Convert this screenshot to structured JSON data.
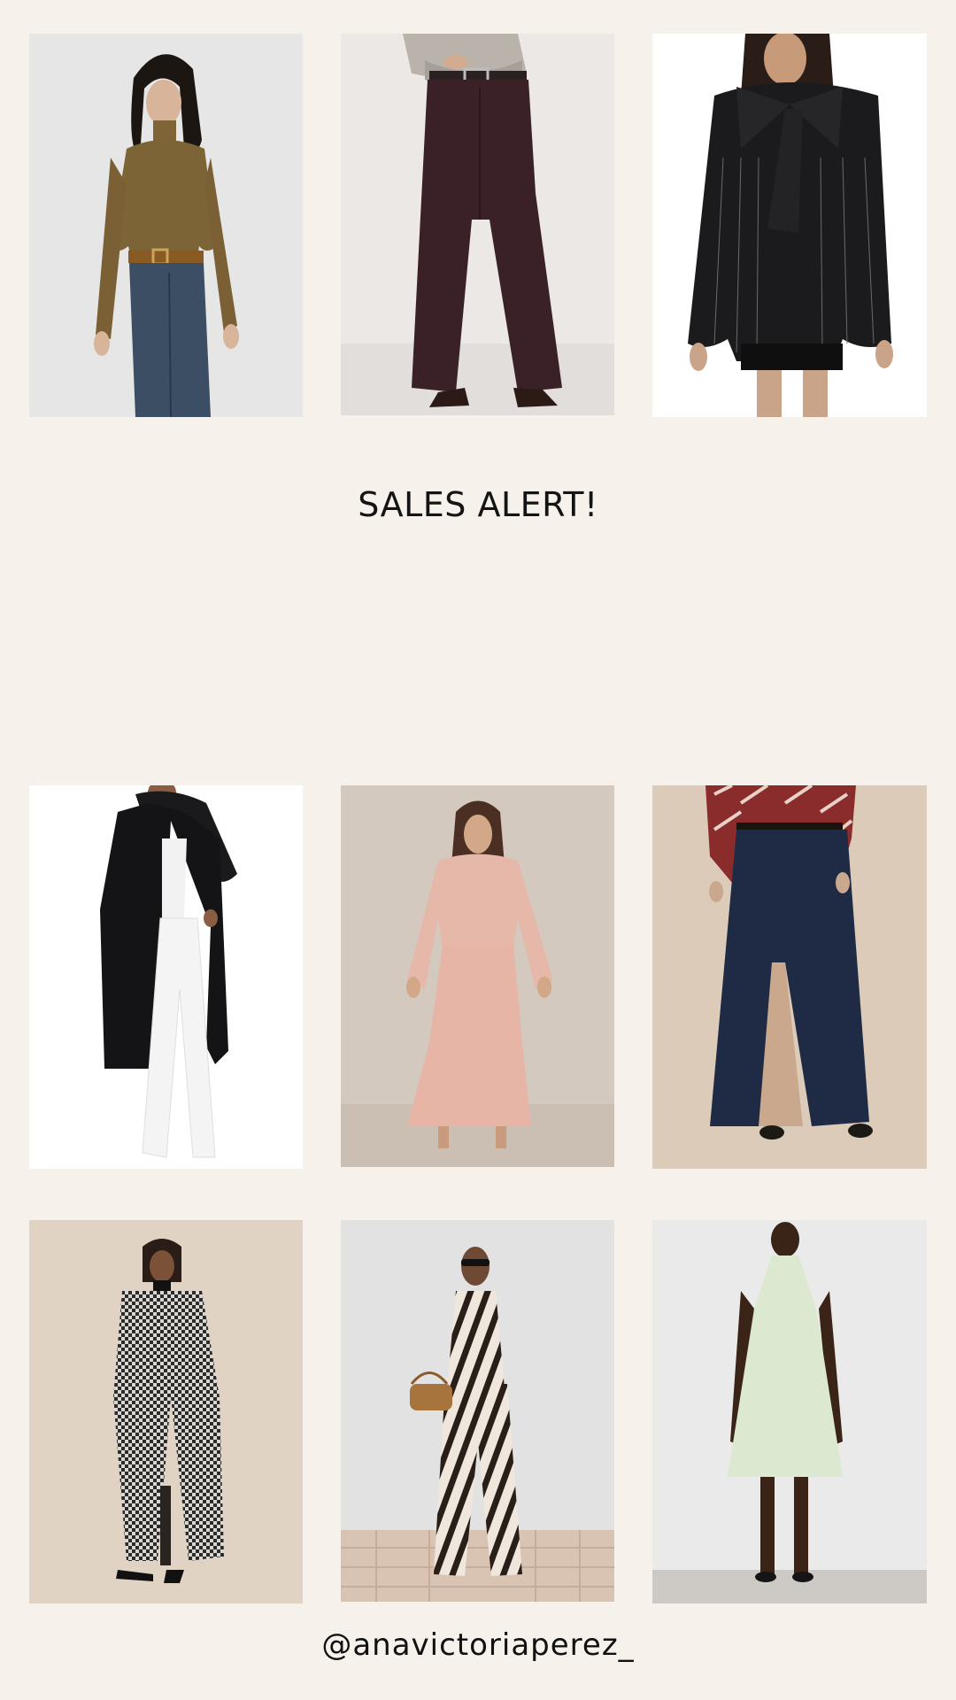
{
  "headline": "SALES ALERT!",
  "handle": "@anavictoriaperez_",
  "colors": {
    "background": "#f6f1ea",
    "text": "#141414"
  },
  "products": [
    {
      "row": 1,
      "col": 1,
      "depicts": "brown turtleneck top"
    },
    {
      "row": 1,
      "col": 2,
      "depicts": "burgundy corduroy flare pants"
    },
    {
      "row": 1,
      "col": 3,
      "depicts": "black pinstripe bow blazer"
    },
    {
      "row": 2,
      "col": 1,
      "depicts": "black wool coat"
    },
    {
      "row": 2,
      "col": 2,
      "depicts": "blush satin maxi skirt set"
    },
    {
      "row": 2,
      "col": 3,
      "depicts": "dark denim maxi skirt"
    },
    {
      "row": 3,
      "col": 1,
      "depicts": "houndstooth long coat"
    },
    {
      "row": 3,
      "col": 2,
      "depicts": "zebra print halter set"
    },
    {
      "row": 3,
      "col": 3,
      "depicts": "mint halter mini dress"
    }
  ]
}
